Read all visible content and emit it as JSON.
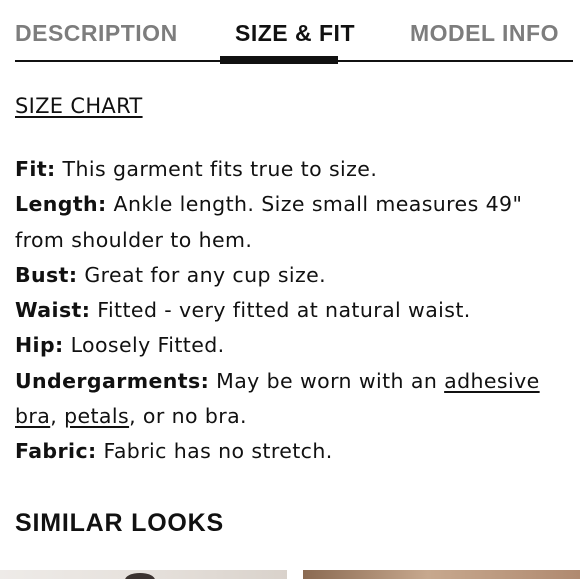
{
  "tabs": [
    {
      "label": "DESCRIPTION",
      "active": false
    },
    {
      "label": "SIZE & FIT",
      "active": true
    },
    {
      "label": "MODEL INFO",
      "active": false
    }
  ],
  "size_chart_link": "SIZE CHART",
  "specs": {
    "fit": {
      "label": "Fit:",
      "text": " This garment fits true to size."
    },
    "length": {
      "label": "Length:",
      "text": " Ankle length. Size small measures 49\" from shoulder to hem."
    },
    "bust": {
      "label": "Bust:",
      "text": " Great for any cup size."
    },
    "waist": {
      "label": "Waist:",
      "text": " Fitted - very fitted at natural waist."
    },
    "hip": {
      "label": "Hip:",
      "text": " Loosely Fitted."
    },
    "undergarments": {
      "label": "Undergarments:",
      "text_before": " May be worn with an ",
      "link_adhesive": "adhesive bra",
      "sep": ", ",
      "link_petals": "petals",
      "text_after": ", or no bra."
    },
    "fabric": {
      "label": "Fabric:",
      "text": " Fabric has no stretch."
    }
  },
  "similar_looks_title": "SIMILAR LOOKS",
  "colors": {
    "text": "#111111",
    "inactive_tab": "#7d7d7d",
    "background": "#ffffff"
  }
}
